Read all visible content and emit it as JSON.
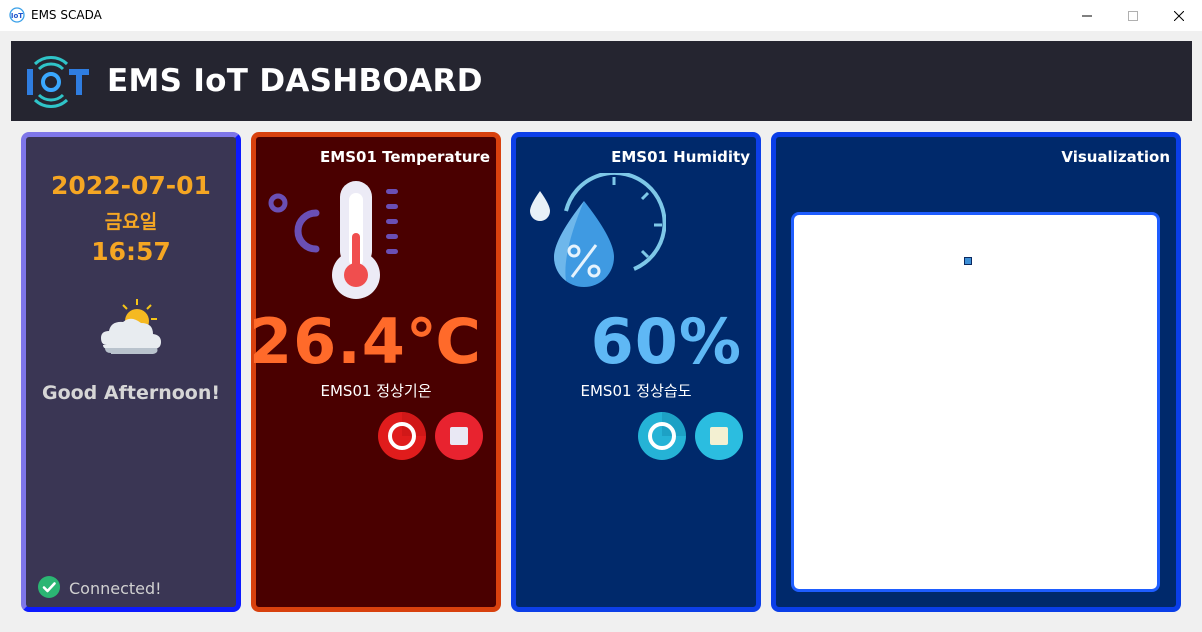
{
  "window": {
    "title": "EMS SCADA",
    "controls": {
      "minimize": "—",
      "maximize": "☐",
      "close": "✕"
    }
  },
  "header": {
    "title": "EMS IoT DASHBOARD",
    "logo_icon": "iot-wifi-logo",
    "background": "#252530"
  },
  "status_panel": {
    "date": "2022-07-01",
    "weekday": "금요일",
    "time": "16:57",
    "weather_icon": "partly-cloudy-sun-icon",
    "greeting": "Good Afternoon!",
    "connection": {
      "icon": "check-circle-icon",
      "text": "Connected!",
      "color": "#2bb673"
    }
  },
  "temperature_panel": {
    "title": "EMS01 Temperature",
    "icon": "thermometer-celsius-icon",
    "value": "26.4℃",
    "label": "EMS01 정상기온",
    "value_color": "#ff6a2a",
    "buttons": [
      {
        "name": "record-button",
        "icon": "ring-icon"
      },
      {
        "name": "stop-button",
        "icon": "square-icon"
      }
    ]
  },
  "humidity_panel": {
    "title": "EMS01 Humidity",
    "icon": "humidity-drop-gauge-icon",
    "value": "60%",
    "label": "EMS01 정상습도",
    "value_color": "#5fb8f5",
    "buttons": [
      {
        "name": "record-button",
        "icon": "ring-icon"
      },
      {
        "name": "stop-button",
        "icon": "square-icon"
      }
    ]
  },
  "visualization_panel": {
    "title": "Visualization"
  }
}
